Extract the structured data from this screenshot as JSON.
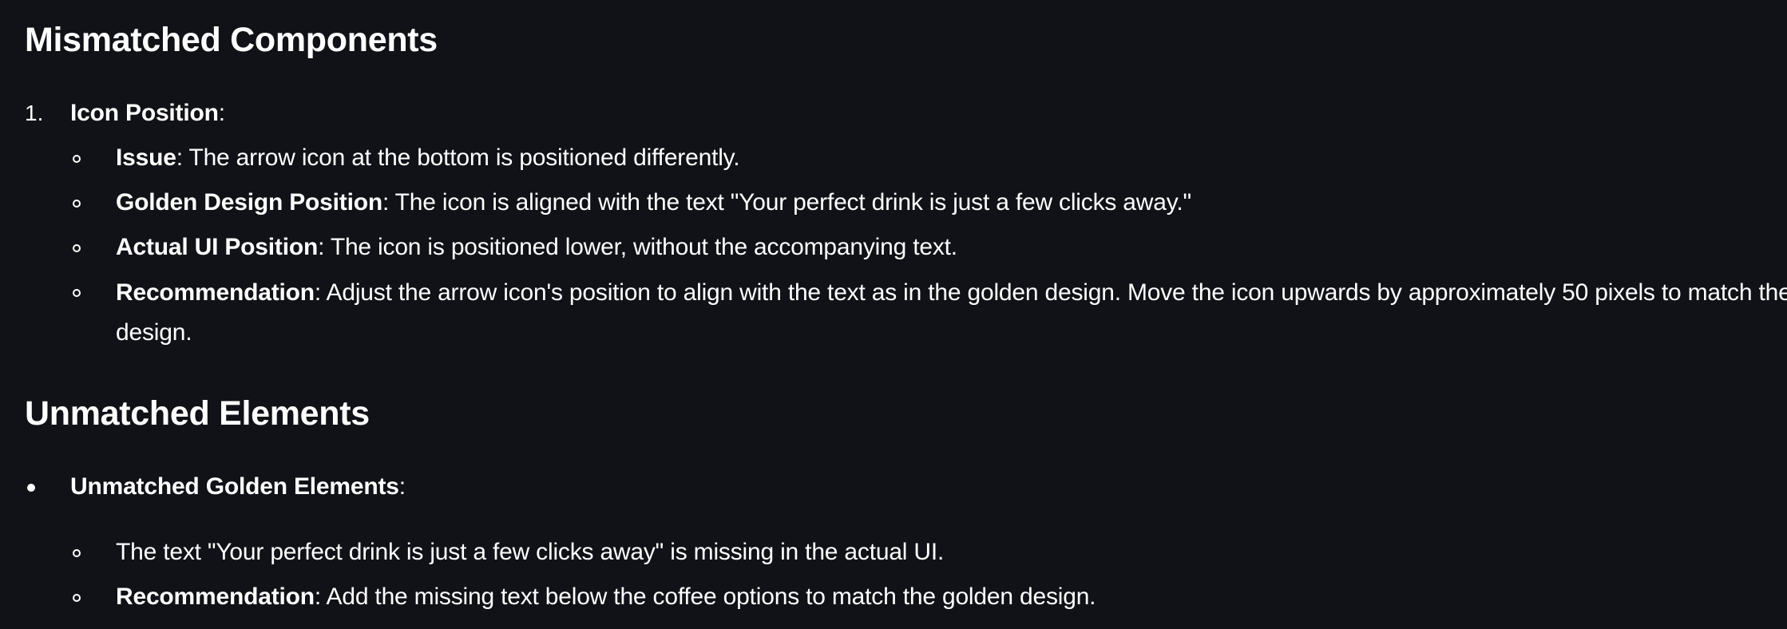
{
  "sections": {
    "mismatched": {
      "heading": "Mismatched Components",
      "item1": {
        "number": "1.",
        "title": "Icon Position",
        "colon": ":",
        "bullets": [
          {
            "label": "Issue",
            "text": ": The arrow icon at the bottom is positioned differently."
          },
          {
            "label": "Golden Design Position",
            "text": ": The icon is aligned with the text \"Your perfect drink is just a few clicks away.\""
          },
          {
            "label": "Actual UI Position",
            "text": ": The icon is positioned lower, without the accompanying text."
          },
          {
            "label": "Recommendation",
            "text": ": Adjust the arrow icon's position to align with the text as in the golden design. Move the icon upwards by approximately 50 pixels to match the design."
          }
        ]
      }
    },
    "unmatched": {
      "heading": "Unmatched Elements",
      "item1": {
        "title": "Unmatched Golden Elements",
        "colon": ":",
        "bullets": [
          {
            "label": "",
            "text": "The text \"Your perfect drink is just a few clicks away\" is missing in the actual UI."
          },
          {
            "label": "Recommendation",
            "text": ": Add the missing text below the coffee options to match the golden design."
          }
        ]
      }
    }
  }
}
